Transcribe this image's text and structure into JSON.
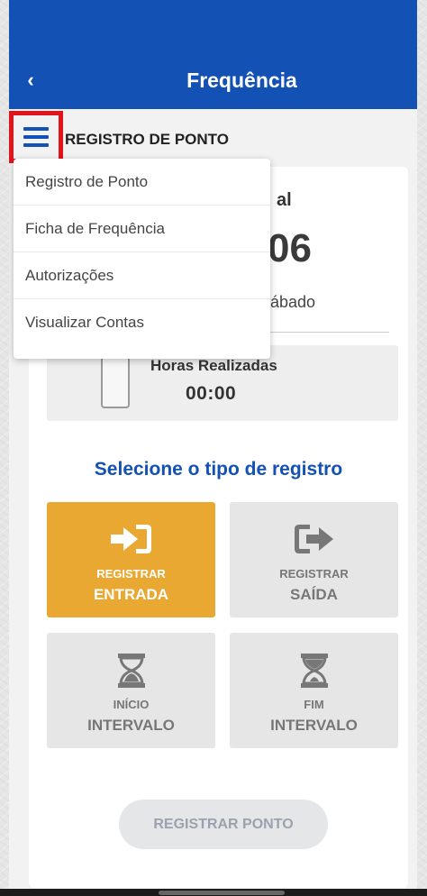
{
  "app_bar": {
    "title": "Frequência",
    "back_icon": "chevron-left-icon"
  },
  "section": {
    "title": "REGISTRO DE PONTO",
    "menu_icon": "hamburger-menu-icon"
  },
  "menu": {
    "items": [
      {
        "label": "Registro de Ponto"
      },
      {
        "label": "Ficha de Frequência"
      },
      {
        "label": "Autorizações"
      },
      {
        "label": "Visualizar Contas"
      }
    ]
  },
  "clock": {
    "label_fragment": "al",
    "time_fragment": "06",
    "day_fragment": "ábado"
  },
  "hours": {
    "label": "Horas Realizadas",
    "value": "00:00"
  },
  "select": {
    "title": "Selecione o tipo de registro"
  },
  "tiles": [
    {
      "line1": "REGISTRAR",
      "line2": "ENTRADA",
      "icon": "sign-in-icon",
      "active": true
    },
    {
      "line1": "REGISTRAR",
      "line2": "SAÍDA",
      "icon": "sign-out-icon",
      "active": false
    },
    {
      "line1": "INÍCIO",
      "line2": "INTERVALO",
      "icon": "hourglass-icon",
      "active": false
    },
    {
      "line1": "FIM",
      "line2": "INTERVALO",
      "icon": "hourglass-icon",
      "active": false
    }
  ],
  "submit": {
    "label": "REGISTRAR PONTO"
  },
  "colors": {
    "primary": "#1351b4",
    "accent": "#e8a832",
    "highlight": "#e3131b"
  }
}
